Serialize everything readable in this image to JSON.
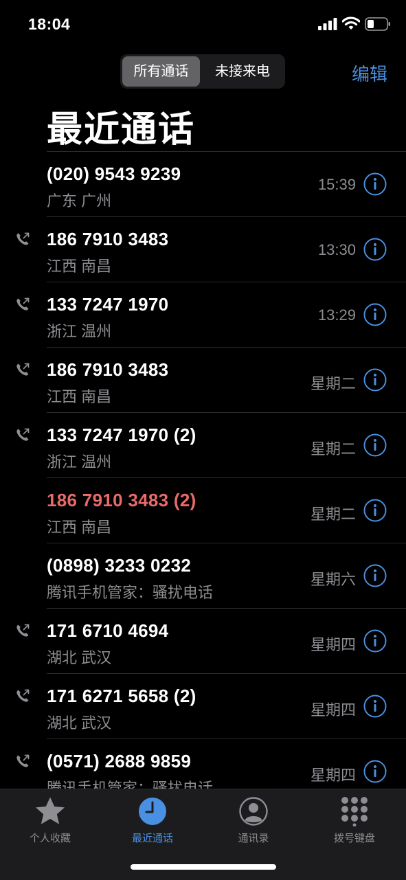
{
  "status_bar": {
    "time": "18:04"
  },
  "segment": {
    "all_label": "所有通话",
    "missed_label": "未接来电"
  },
  "edit_label": "编辑",
  "page_title": "最近通话",
  "calls": [
    {
      "number": "(020) 9543 9239",
      "location": "广东 广州",
      "time": "15:39",
      "outgoing": false,
      "missed": false
    },
    {
      "number": "186 7910 3483",
      "location": "江西 南昌",
      "time": "13:30",
      "outgoing": true,
      "missed": false
    },
    {
      "number": "133 7247 1970",
      "location": "浙江 温州",
      "time": "13:29",
      "outgoing": true,
      "missed": false
    },
    {
      "number": "186 7910 3483",
      "location": "江西 南昌",
      "time": "星期二",
      "outgoing": true,
      "missed": false
    },
    {
      "number": "133 7247 1970 (2)",
      "location": "浙江 温州",
      "time": "星期二",
      "outgoing": true,
      "missed": false
    },
    {
      "number": "186 7910 3483 (2)",
      "location": "江西 南昌",
      "time": "星期二",
      "outgoing": false,
      "missed": true
    },
    {
      "number": "(0898) 3233 0232",
      "location": "腾讯手机管家：骚扰电话",
      "time": "星期六",
      "outgoing": false,
      "missed": false
    },
    {
      "number": "171 6710 4694",
      "location": "湖北 武汉",
      "time": "星期四",
      "outgoing": true,
      "missed": false
    },
    {
      "number": "171 6271 5658 (2)",
      "location": "湖北 武汉",
      "time": "星期四",
      "outgoing": true,
      "missed": false
    },
    {
      "number": "(0571) 2688 9859",
      "location": "腾讯手机管家：骚扰电话",
      "time": "星期四",
      "outgoing": true,
      "missed": false
    }
  ],
  "tabs": [
    {
      "label": "个人收藏",
      "icon": "star-icon"
    },
    {
      "label": "最近通话",
      "icon": "clock-icon"
    },
    {
      "label": "通讯录",
      "icon": "person-icon"
    },
    {
      "label": "拨号键盘",
      "icon": "keypad-icon"
    }
  ],
  "colors": {
    "accent": "#4a90e2",
    "missed": "#e86a6a",
    "secondary_text": "#8e8e93"
  }
}
